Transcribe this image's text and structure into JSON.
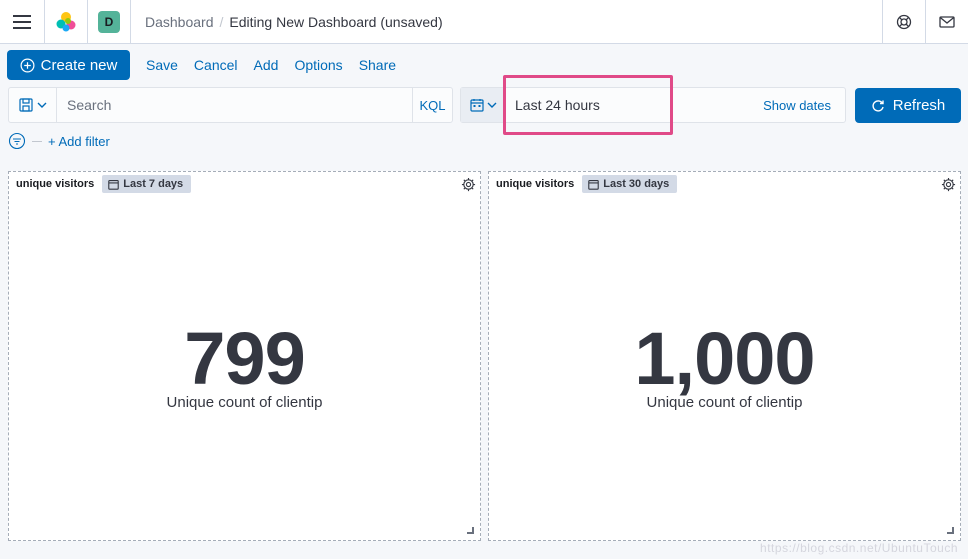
{
  "header": {
    "breadcrumb_root": "Dashboard",
    "breadcrumb_current": "Editing New Dashboard (unsaved)",
    "space_initial": "D",
    "icons": [
      "menu-icon",
      "elastic-logo",
      "help-icon",
      "mail-icon"
    ]
  },
  "toolbar": {
    "create_new": "Create new",
    "save": "Save",
    "cancel": "Cancel",
    "add": "Add",
    "options": "Options",
    "share": "Share"
  },
  "query": {
    "placeholder": "Search",
    "language": "KQL"
  },
  "timepicker": {
    "range": "Last 24 hours",
    "show_dates": "Show dates",
    "refresh": "Refresh"
  },
  "filters": {
    "add_filter": "+ Add filter"
  },
  "panels": [
    {
      "title": "unique visitors",
      "time_badge": "Last 7 days",
      "value": "799",
      "label": "Unique count of clientip"
    },
    {
      "title": "unique visitors",
      "time_badge": "Last 30 days",
      "value": "1,000",
      "label": "Unique count of clientip"
    }
  ],
  "watermark": "https://blog.csdn.net/UbuntuTouch",
  "colors": {
    "primary": "#006bb8",
    "highlight": "#e04a88",
    "avatar": "#54b399"
  }
}
